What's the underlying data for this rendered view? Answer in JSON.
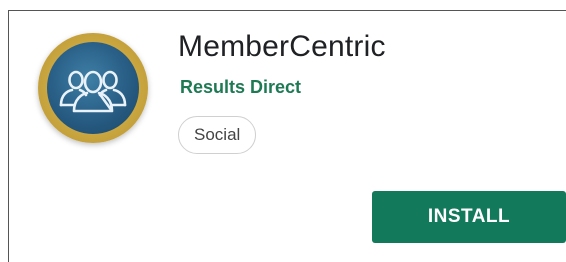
{
  "app": {
    "title": "MemberCentric",
    "developer": "Results Direct",
    "category": "Social",
    "icon": "group-of-people-icon"
  },
  "actions": {
    "install_label": "INSTALL"
  },
  "colors": {
    "developer": "#1e7a54",
    "install_button": "#12795a",
    "icon_ring": "#c9a640",
    "icon_fill": "#2b628a"
  }
}
